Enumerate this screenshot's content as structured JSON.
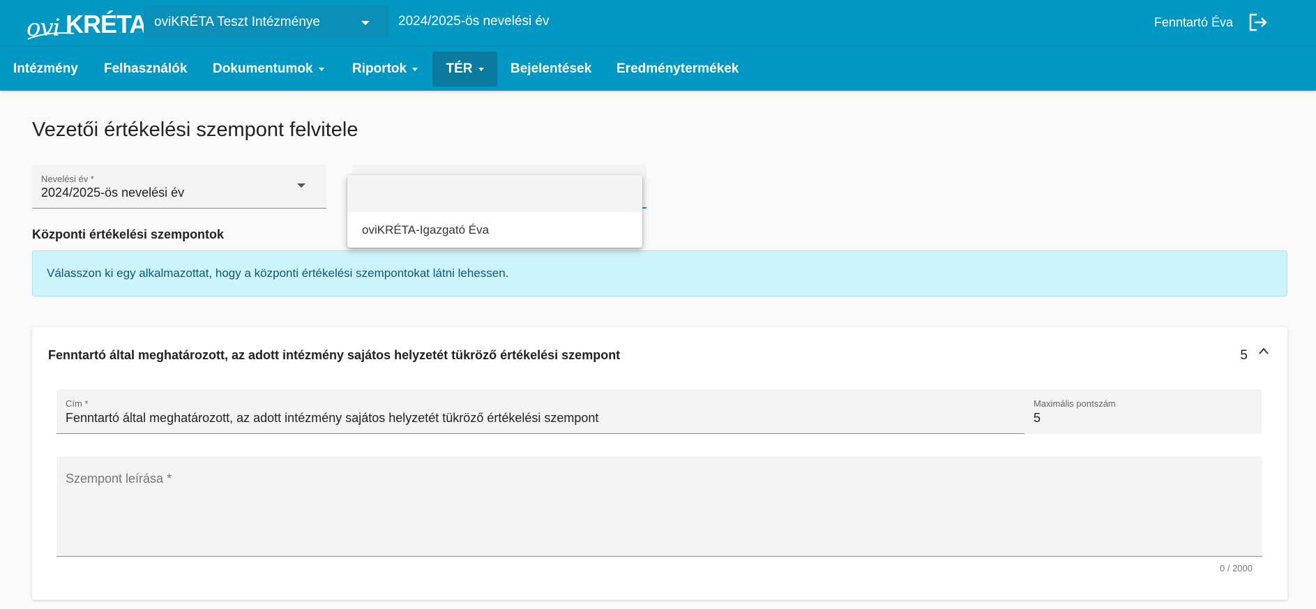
{
  "header": {
    "logo_ovi": "ovi",
    "logo_kreta": "KRÉTA",
    "institution": "oviKRÉTA Teszt Intézménye",
    "school_year": "2024/2025-ös nevelési év",
    "user": "Fenntartó Éva"
  },
  "nav": {
    "items": [
      {
        "label": "Intézmény"
      },
      {
        "label": "Felhasználók"
      },
      {
        "label": "Dokumentumok"
      },
      {
        "label": "Riportok"
      },
      {
        "label": "TÉR"
      },
      {
        "label": "Bejelentések"
      },
      {
        "label": "Eredménytermékek"
      }
    ]
  },
  "page": {
    "title": "Vezetői értékelési szempont felvitele",
    "year_field": {
      "label": "Nevelési év *",
      "value": "2024/2025-ös nevelési év"
    },
    "dropdown_options": [
      "oviKRÉTA-Igazgató Éva"
    ],
    "section_label": "Központi értékelési szempontok",
    "info_text": "Válasszon ki egy alkalmazottat, hogy a központi értékelési szempontokat látni lehessen."
  },
  "card": {
    "title": "Fenntartó által meghatározott, az adott intézmény sajátos helyzetét tükröző értékelési szempont",
    "count": "5",
    "title_field": {
      "label": "Cím *",
      "value": "Fenntartó által meghatározott, az adott intézmény sajátos helyzetét tükröző értékelési szempont"
    },
    "max_field": {
      "label": "Maximális pontszám",
      "value": "5"
    },
    "description_field": {
      "placeholder": "Szempont leírása *",
      "char_count": "0 / 2000"
    }
  },
  "colors": {
    "primary": "#0098c3",
    "info_bg": "#cdf3fc"
  }
}
